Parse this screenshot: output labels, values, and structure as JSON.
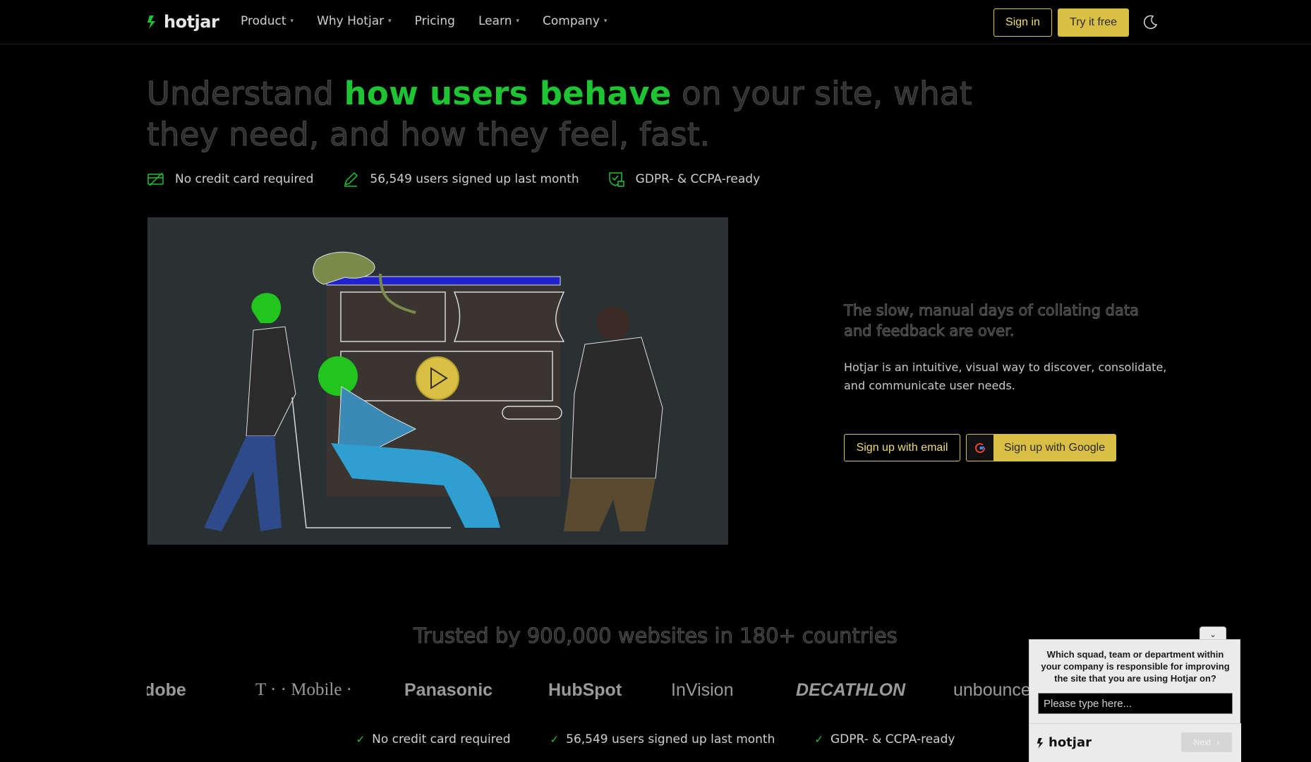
{
  "nav": {
    "logo": "hotjar",
    "menu": [
      {
        "label": "Product",
        "dropdown": true
      },
      {
        "label": "Why Hotjar",
        "dropdown": true
      },
      {
        "label": "Pricing",
        "dropdown": false
      },
      {
        "label": "Learn",
        "dropdown": true
      },
      {
        "label": "Company",
        "dropdown": true
      }
    ],
    "sign_in": "Sign in",
    "try_free": "Try it free"
  },
  "hero": {
    "headline_pre": "Understand ",
    "headline_highlight": "how users behave",
    "headline_post": " on your site, what they need, and how they feel, fast.",
    "badges": [
      {
        "icon": "credit-card-icon",
        "label": "No credit card required"
      },
      {
        "icon": "pencil-icon",
        "label": "56,549 users signed up last month"
      },
      {
        "icon": "shield-lock-icon",
        "label": "GDPR- & CCPA-ready"
      }
    ],
    "lead": "The slow, manual days of collating data and feedback are over.",
    "sub": "Hotjar is an intuitive, visual way to discover, consolidate, and communicate user needs.",
    "signup_email": "Sign up with email",
    "signup_google": "Sign up with Google"
  },
  "trusted": {
    "title": "Trusted by 900,000 websites in 180+ countries",
    "logos": [
      "Adobe",
      "T · · Mobile ·",
      "Panasonic",
      "HubSpot",
      "InVision",
      "DECATHLON",
      "unbounce"
    ],
    "checks": [
      "No credit card required",
      "56,549 users signed up last month",
      "GDPR- & CCPA-ready"
    ]
  },
  "widget": {
    "question": "Which squad, team or department within your company is responsible for improving the site that you are using Hotjar on?",
    "placeholder": "Please type here...",
    "logo": "hotjar",
    "next": "Next"
  },
  "colors": {
    "accent_green": "#1fc432",
    "brand_yellow": "#d9bf44",
    "background": "#000000"
  }
}
